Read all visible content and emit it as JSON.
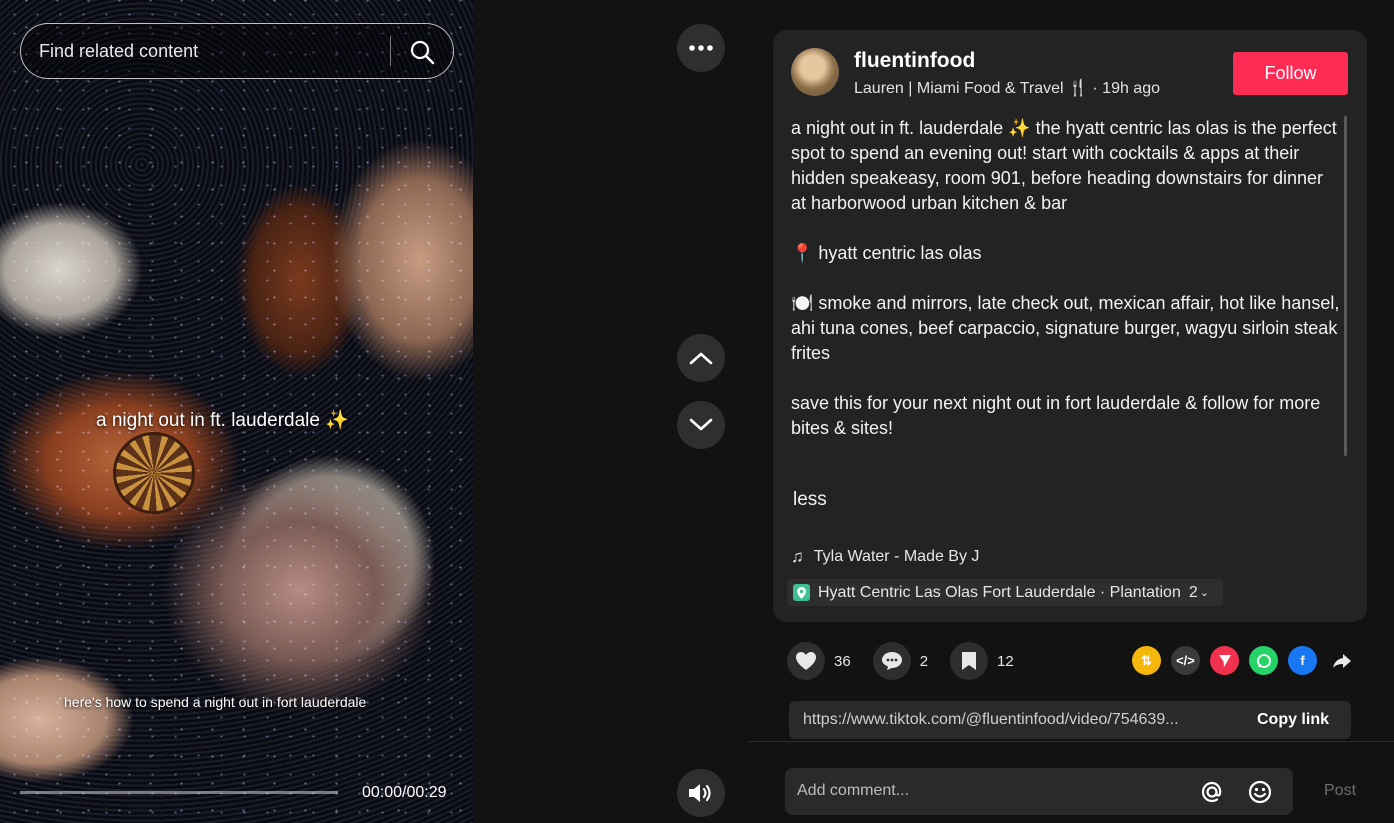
{
  "search": {
    "placeholder": "Find related content"
  },
  "video": {
    "caption_main": "a night out in ft. lauderdale ✨",
    "caption_sub": "here's how to spend a night out in fort lauderdale",
    "time": "00:00/00:29",
    "progress": 0.0
  },
  "author": {
    "username": "fluentinfood",
    "subtitle": "Lauren | Miami Food & Travel 🍴 · 19h ago",
    "follow_label": "Follow"
  },
  "description": [
    "a night out in ft. lauderdale ✨ the hyatt centric las olas is the perfect spot to spend an evening out! start with cocktails & apps at their hidden speakeasy, room 901, before heading downstairs for dinner at harborwood urban kitchen & bar",
    "📍 hyatt centric las olas",
    "🍽️ smoke and mirrors, late check out, mexican affair, hot like hansel, ahi tuna cones, beef carpaccio, signature burger, wagyu sirloin steak frites",
    "save this for your next night out in fort lauderdale & follow for more bites & sites!"
  ],
  "less_label": "less",
  "music": "Tyla Water - Made By J",
  "location": {
    "label": "Hyatt Centric Las Olas Fort Lauderdale · Plantation",
    "count": "2"
  },
  "stats": {
    "likes": "36",
    "comments": "2",
    "saves": "12"
  },
  "share_icons": [
    "repost-icon",
    "embed-icon",
    "send-icon",
    "whatsapp-icon",
    "facebook-icon",
    "share-icon"
  ],
  "link": {
    "url": "https://www.tiktok.com/@fluentinfood/video/754639...",
    "copy_label": "Copy link"
  },
  "comment": {
    "placeholder": "Add comment...",
    "post_label": "Post"
  },
  "colors": {
    "accent": "#fe2c55",
    "panel": "#232323",
    "background": "#121212"
  }
}
